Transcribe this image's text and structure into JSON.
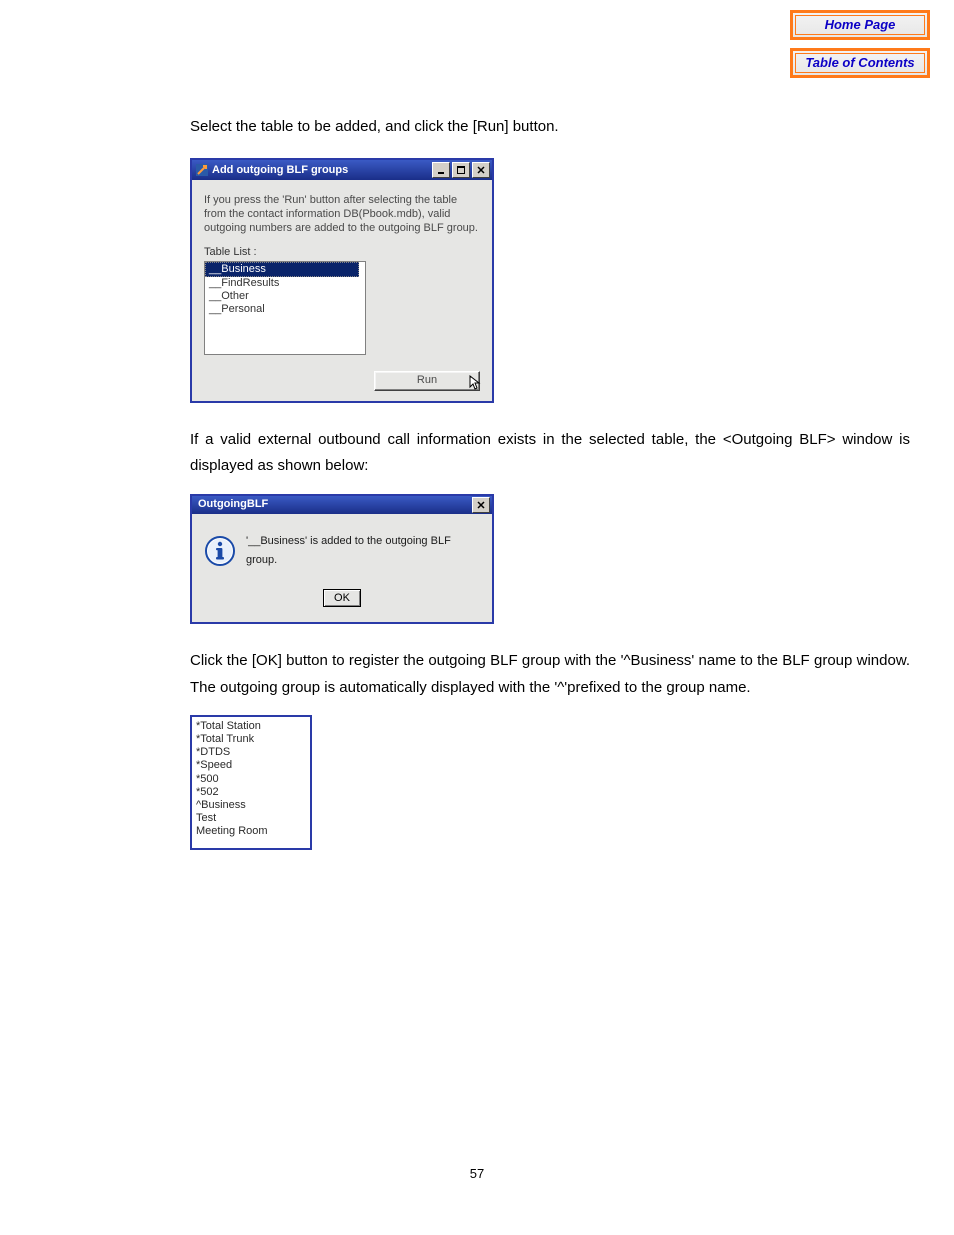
{
  "nav": {
    "home": "Home Page",
    "toc": "Table of Contents"
  },
  "text": {
    "p1": "Select the table to be added, and click the [Run] button.",
    "p2": "If a valid external outbound call information exists in the selected table, the <Outgoing BLF> window is displayed as shown below:",
    "p3": "Click the [OK] button to register the outgoing BLF group with the '^Business' name to the BLF group window. The outgoing group is automatically displayed with the '^'prefixed to the group name."
  },
  "dlg1": {
    "title": "Add outgoing BLF groups",
    "instr": "If you press the 'Run' button after selecting the table from the contact information DB(Pbook.mdb), valid outgoing numbers are added to the outgoing BLF group.",
    "table_list_label": "Table List :",
    "items": {
      "i0": "__Business",
      "i1": "__FindResults",
      "i2": "__Other",
      "i3": "__Personal"
    },
    "run_label": "Run"
  },
  "dlg2": {
    "title": "OutgoingBLF",
    "message": "'__Business' is added to the outgoing BLF group.",
    "ok_label": "OK"
  },
  "blf_list": {
    "i0": "*Total Station",
    "i1": "*Total Trunk",
    "i2": "*DTDS",
    "i3": "*Speed",
    "i4": "*500",
    "i5": "*502",
    "i6": "^Business",
    "i7": "Test",
    "i8": "Meeting Room"
  },
  "page_number": "57"
}
